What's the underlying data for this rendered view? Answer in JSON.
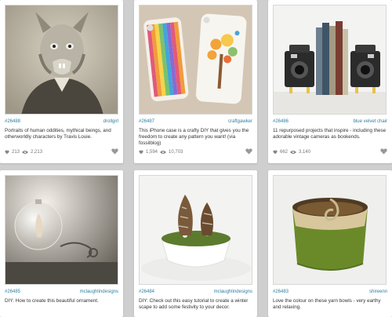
{
  "cards": [
    {
      "id": "#26488",
      "user": "drollgirl",
      "description": "Portraits of human oddities, mythical beings, and otherworldly characters by Travis Louie.",
      "likes": "213",
      "views": "2,213"
    },
    {
      "id": "#26487",
      "user": "craftgawker",
      "description": "This iPhone case is a crafty DIY that gives you the freedom to create any pattern you want! (via fossilblog)",
      "likes": "1,594",
      "views": "10,703"
    },
    {
      "id": "#26486",
      "user": "blue velvet chair",
      "description": "11 repurposed projects that inspire - including these adorable vintage cameras as bookends.",
      "likes": "662",
      "views": "3,140"
    },
    {
      "id": "#26485",
      "user": "mclaughlindesigns",
      "description": "DIY: How to create this beautiful ornament."
    },
    {
      "id": "#26484",
      "user": "mclaughlindesigns",
      "description": "DIY: Check out this easy tutorial to create a winter scape to add some festivity to your decor."
    },
    {
      "id": "#26483",
      "user": "shireenn",
      "description": "Love the colour on these yarn bowls - very earthy and relaxing."
    }
  ],
  "icons": {
    "like": "heart-icon",
    "views": "eye-icon",
    "favorite": "heart-icon"
  },
  "colors": {
    "background": "#cfcfcf",
    "link": "#2f7fa0",
    "text": "#333333",
    "stats": "#777777"
  }
}
